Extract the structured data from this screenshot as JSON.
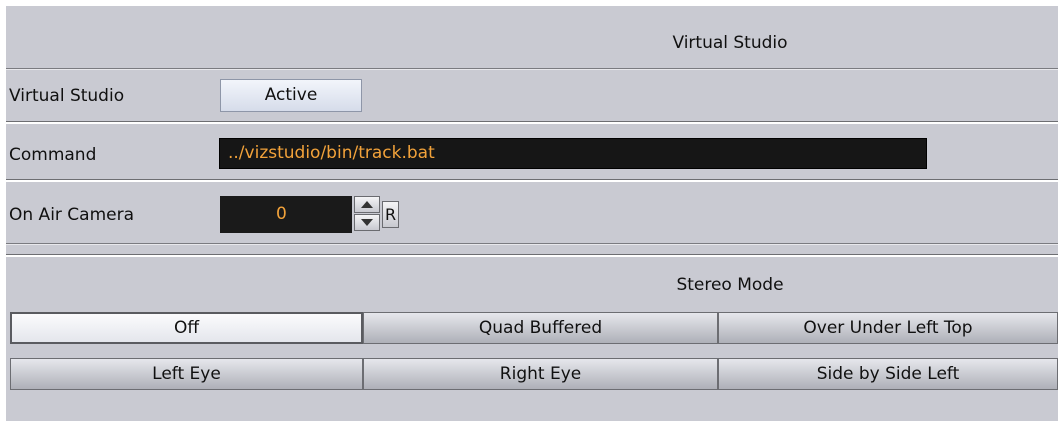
{
  "virtual_studio": {
    "header": "Virtual Studio",
    "label": "Virtual Studio",
    "toggle_label": "Active",
    "command_label": "Command",
    "command_value": "../vizstudio/bin/track.bat",
    "camera_label": "On Air Camera",
    "camera_value": "0",
    "reset_label": "R"
  },
  "stereo": {
    "header": "Stereo Mode",
    "options": [
      "Off",
      "Quad Buffered",
      "Over Under Left Top",
      "Left Eye",
      "Right Eye",
      "Side by Side Left"
    ],
    "selected": "Off"
  },
  "colors": {
    "panel": "#c9cad2",
    "value_text": "#f2a23a",
    "field_bg": "#161616"
  }
}
